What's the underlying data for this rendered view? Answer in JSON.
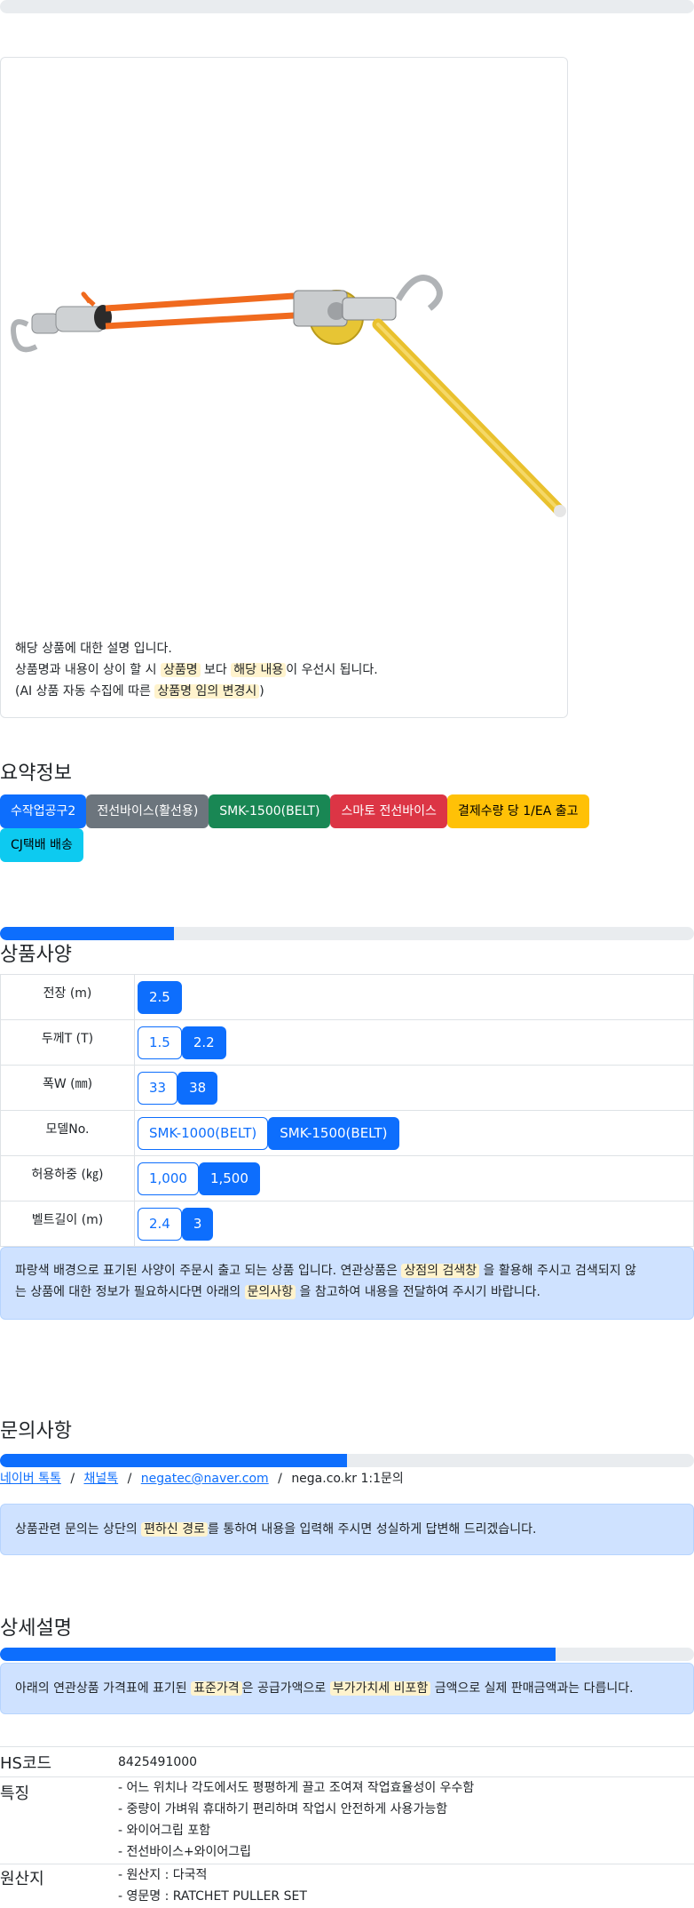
{
  "top_progress": 0,
  "product_description": {
    "line1": "해당 상품에 대한 설명 입니다.",
    "line2_pre": "상품명과 내용이 상이 할 시",
    "line2_hl1": "상품명",
    "line2_mid": "보다",
    "line2_hl2": "해당 내용",
    "line2_post": "이 우선시 됩니다.",
    "line3_pre": "(AI 상품 자동 수집에 따른",
    "line3_hl": "상품명 임의 변경시",
    "line3_post": ")"
  },
  "summary": {
    "title": "요약정보",
    "badges": [
      {
        "label": "수작업공구2",
        "color": "#0d6efd",
        "text_color": "#ffffff"
      },
      {
        "label": "전선바이스(활선용)",
        "color": "#6c757d",
        "text_color": "#ffffff"
      },
      {
        "label": "SMK-1500(BELT)",
        "color": "#198754",
        "text_color": "#ffffff"
      },
      {
        "label": "스마토 전선바이스",
        "color": "#dc3545",
        "text_color": "#ffffff"
      },
      {
        "label": "결제수량 당 1/EA 출고",
        "color": "#ffc107",
        "text_color": "#000000"
      },
      {
        "label": "CJ택배 배송",
        "color": "#0dcaf0",
        "text_color": "#000000"
      }
    ]
  },
  "specs": {
    "progress": 25,
    "title": "상품사양",
    "rows": [
      {
        "label": "전장 (m)",
        "options": [
          {
            "v": "2.5",
            "sel": true
          }
        ]
      },
      {
        "label": "두께T (T)",
        "options": [
          {
            "v": "1.5",
            "sel": false
          },
          {
            "v": "2.2",
            "sel": true
          }
        ]
      },
      {
        "label": "폭W (㎜)",
        "options": [
          {
            "v": "33",
            "sel": false
          },
          {
            "v": "38",
            "sel": true
          }
        ]
      },
      {
        "label": "모델No.",
        "options": [
          {
            "v": "SMK-1000(BELT)",
            "sel": false
          },
          {
            "v": "SMK-1500(BELT)",
            "sel": true
          }
        ]
      },
      {
        "label": "허용하중 (㎏)",
        "options": [
          {
            "v": "1,000",
            "sel": false
          },
          {
            "v": "1,500",
            "sel": true
          }
        ]
      },
      {
        "label": "벨트길이 (m)",
        "options": [
          {
            "v": "2.4",
            "sel": false
          },
          {
            "v": "3",
            "sel": true
          }
        ]
      }
    ],
    "notice_pre": "파랑색 배경으로 표기된 사양이 주문시 출고 되는 상품 입니다. 연관상품은",
    "notice_hl1": "상점의 검색창",
    "notice_mid1": "을 활용해 주시고 검색되지 않",
    "notice_line2_pre": "는 상품에 대한 정보가 필요하시다면 아래의",
    "notice_hl2": "문의사항",
    "notice_post": "을 참고하여 내용을 전달하여 주시기 바랍니다."
  },
  "inquiry": {
    "title": "문의사항",
    "progress": 50,
    "links": [
      "네이버 톡톡",
      "채널톡",
      "negatec@naver.com"
    ],
    "sep": "/",
    "plain": "nega.co.kr 1:1문의",
    "notice_pre": "상품관련 문의는 상단의",
    "notice_hl": "편하신 경로",
    "notice_post": "를 통하여 내용을 입력해 주시면 성실하게 답변해 드리겠습니다."
  },
  "detail": {
    "title": "상세설명",
    "progress": 80,
    "notice_pre": "아래의 연관상품 가격표에 표기된",
    "notice_hl1": "표준가격",
    "notice_mid": "은 공급가액으로",
    "notice_hl2": "부가가치세 비포함",
    "notice_post": "금액으로 실제 판매금액과는 다릅니다.",
    "hs_label": "HS코드",
    "hs_value": "8425491000",
    "feature_label": "특징",
    "features": [
      "- 어느 위치나 각도에서도 평평하게 끌고 조여져 작업효율성이 우수함",
      "- 중량이 가벼워 휴대하기 편리하며 작업시 안전하게 사용가능함",
      "- 와이어그립 포함",
      "- 전선바이스+와이어그립"
    ],
    "origin_label": "원산지",
    "origins": [
      "- 원산지 : 다국적",
      "- 영문명 : RATCHET PULLER SET"
    ]
  }
}
